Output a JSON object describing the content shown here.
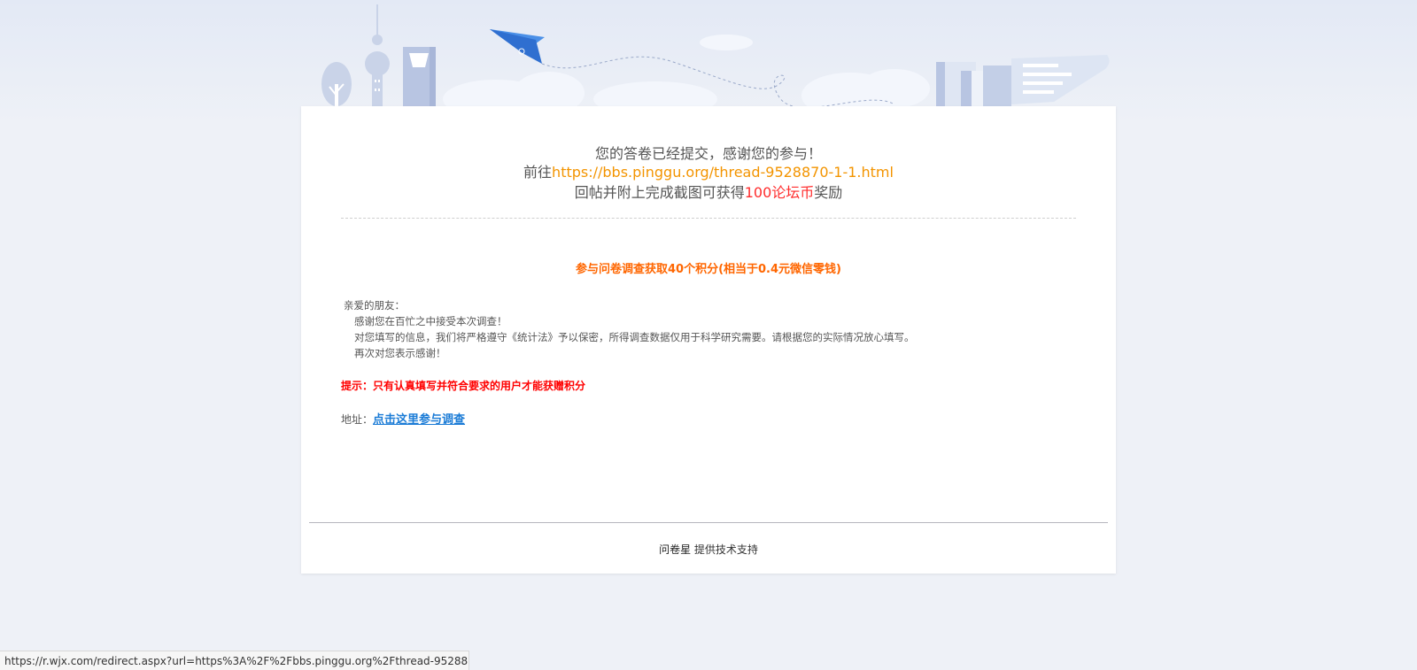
{
  "result": {
    "line1": "您的答卷已经提交，感谢您的参与！",
    "line2_prefix": "前往",
    "line2_link": "https://bbs.pinggu.org/thread-9528870-1-1.html",
    "line3_prefix": "回帖并附上完成截图可获得",
    "line3_highlight": "100论坛币",
    "line3_suffix": "奖励"
  },
  "promo": {
    "title": "参与问卷调查获取40个积分(相当于0.4元微信零钱)",
    "greeting": "亲爱的朋友：",
    "body": [
      "感谢您在百忙之中接受本次调查！",
      "对您填写的信息，我们将严格遵守《统计法》予以保密，所得调查数据仅用于科学研究需要。请根据您的实际情况放心填写。",
      "再次对您表示感谢！"
    ],
    "tip": "提示：只有认真填写并符合要求的用户才能获赠积分",
    "address_label": "地址：",
    "address_link": "点击这里参与调查"
  },
  "footer": {
    "brand": "问卷星",
    "text": " 提供技术支持"
  },
  "status_url": "https://r.wjx.com/redirect.aspx?url=https%3A%2F%2Fbbs.pinggu.org%2Fthread-952887...",
  "colors": {
    "accent_orange": "#f39400",
    "highlight_red": "#ff2d2d",
    "promo_orange": "#ff6600",
    "link_blue": "#1a7bd6"
  }
}
